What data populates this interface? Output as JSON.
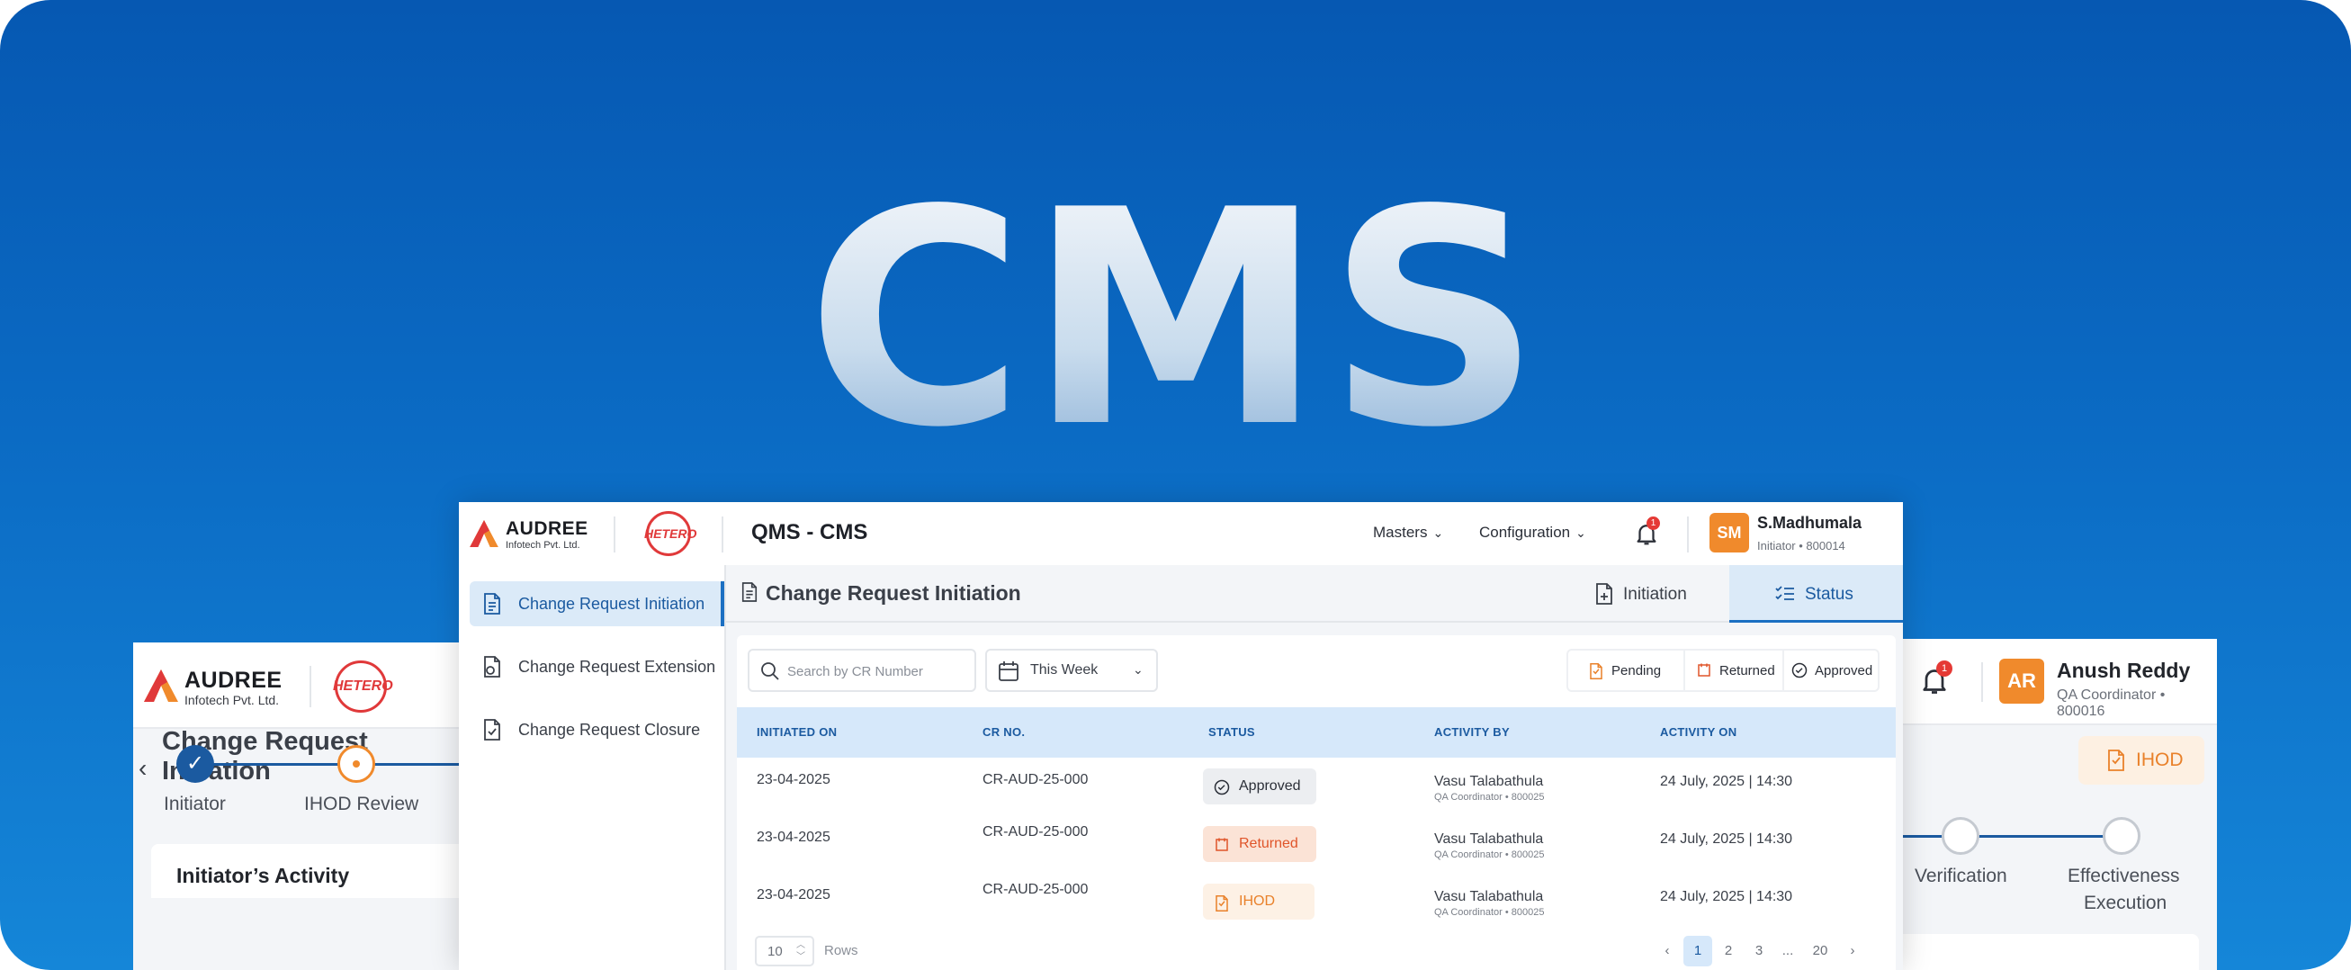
{
  "hero": {
    "title": "CMS"
  },
  "brand": {
    "company_name": "AUDREE",
    "company_sub": "Infotech Pvt. Ltd.",
    "partner_name": "HETERO"
  },
  "main_window": {
    "app_title": "QMS - CMS",
    "nav": [
      {
        "label": "Masters"
      },
      {
        "label": "Configuration"
      }
    ],
    "notification_count": "1",
    "user": {
      "initials": "SM",
      "name": "S.Madhumala",
      "role": "Initiator • 800014"
    },
    "sidebar": {
      "items": [
        {
          "label": "Change Request Initiation",
          "icon": "document-icon",
          "active": true
        },
        {
          "label": "Change Request Extension",
          "icon": "extension-icon",
          "active": false
        },
        {
          "label": "Change Request Closure",
          "icon": "closure-icon",
          "active": false
        }
      ]
    },
    "content": {
      "title": "Change Request Initiation",
      "tabs": [
        {
          "label": "Initiation",
          "icon": "file-add-icon"
        },
        {
          "label": "Status",
          "icon": "checklist-icon",
          "active": true
        }
      ],
      "filters": {
        "search_placeholder": "Search by CR Number",
        "period": "This Week",
        "legend": [
          {
            "label": "Pending",
            "icon": "pending-icon"
          },
          {
            "label": "Returned",
            "icon": "returned-icon"
          },
          {
            "label": "Approved",
            "icon": "approved-icon"
          }
        ]
      },
      "table": {
        "columns": [
          "INITIATED ON",
          "CR NO.",
          "STATUS",
          "ACTIVITY BY",
          "ACTIVITY ON"
        ],
        "rows": [
          {
            "initiated_on": "23-04-2025",
            "cr_no": "CR-AUD-25-000",
            "status": "Approved",
            "activity_by": "Vasu Talabathula",
            "activity_role": "QA Coordinator • 800025",
            "activity_on": "24 July, 2025 | 14:30"
          },
          {
            "initiated_on": "23-04-2025",
            "cr_no": "CR-AUD-25-000",
            "status": "Returned",
            "activity_by": "Vasu Talabathula",
            "activity_role": "QA Coordinator • 800025",
            "activity_on": "24 July, 2025 | 14:30"
          },
          {
            "initiated_on": "23-04-2025",
            "cr_no": "CR-AUD-25-000",
            "status": "IHOD",
            "activity_by": "Vasu Talabathula",
            "activity_role": "QA Coordinator • 800025",
            "activity_on": "24 July, 2025 | 14:30"
          }
        ]
      },
      "pagination": {
        "rows_value": "10",
        "rows_label": "Rows",
        "pages": [
          "1",
          "2",
          "3",
          "...",
          "20"
        ],
        "current": "1",
        "prev_icon": "chevron-left-icon",
        "next_icon": "chevron-right-icon"
      }
    }
  },
  "left_window": {
    "title": "Change Request Initiation",
    "steps": [
      {
        "label": "Initiator",
        "state": "done"
      },
      {
        "label": "IHOD Review",
        "state": "current"
      }
    ],
    "card_title": "Initiator’s Activity"
  },
  "right_window": {
    "notification_count": "1",
    "user": {
      "initials": "AR",
      "name": "Anush Reddy",
      "role": "QA Coordinator • 800016"
    },
    "ihod_label": "IHOD",
    "steps": [
      {
        "label": "Verification",
        "state": "pending"
      },
      {
        "label": "Effectiveness",
        "state": "pending"
      },
      {
        "label": "Execution",
        "state": "pending"
      }
    ]
  },
  "colors": {
    "background_top": "#0658b2",
    "background_bottom": "#1586d8",
    "primary": "#1b5aa0",
    "accent_orange": "#f08a2c",
    "hetero_red": "#e0393a",
    "returned": "#e0552a"
  }
}
